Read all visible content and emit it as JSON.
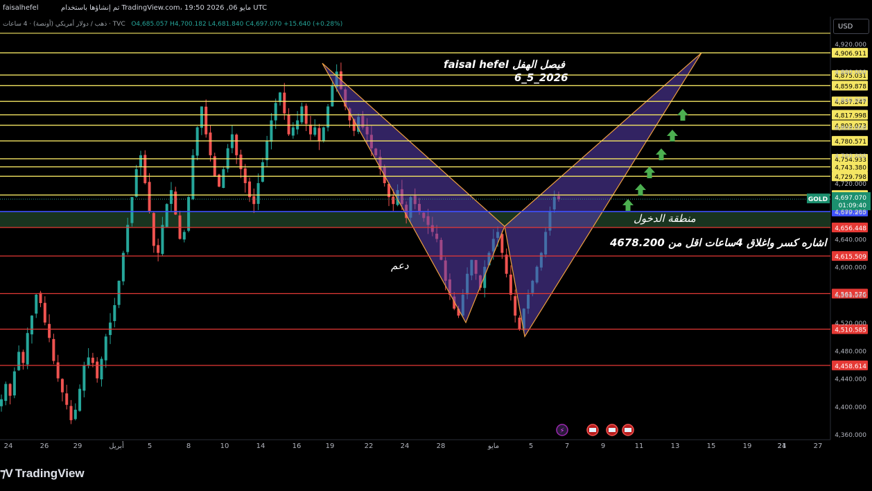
{
  "header": {
    "publisher": "faisalhefel",
    "published_on": "تم إنشاؤها باستخدام TradingView.com، مايو 06, 2026 19:50 UTC"
  },
  "legend_text": "ذهب / دولار أمريكي (أونصة) · 4 ساعات · TVC",
  "legend_ohlc": "O4,685.057  H4,700.182  L4,681.840  C4,697.070  +15.640 (+0.28%)",
  "currency_button": "USD",
  "logo_text": "TradingView",
  "annotations": {
    "author": "faisal hefel فيصل الهفل",
    "date": "6_5_2026",
    "entry_zone": "منطقة الدخول",
    "support": "دعم",
    "stop_note": "اشاره كسر واغلاق 4ساعات اقل من 4678.200"
  },
  "colors": {
    "background": "#000000",
    "bull": "#26a69a",
    "bear": "#ef5350",
    "resistance_line": "#f5e663",
    "support_line": "#e53935",
    "entry_line": "#3f51ff",
    "pattern_fill": "#5b3fb3",
    "pattern_stroke": "#f0a040",
    "arrow": "#4caf50",
    "current_price_tag": "#1b8f6e"
  },
  "chart_data": {
    "type": "candlestick",
    "symbol": "GOLD",
    "timeframe": "4h",
    "x_tick_labels": [
      "24",
      "26",
      "29",
      "أبريل",
      "5",
      "8",
      "10",
      "14",
      "16",
      "19",
      "22",
      "24",
      "28",
      "مايو",
      "5",
      "7",
      "9",
      "11",
      "13",
      "15",
      "19",
      "21",
      "24",
      "27"
    ],
    "y_tick_labels": [
      "4,920.000",
      "4,880.000",
      "4,840.000",
      "4,800.000",
      "4,760.000",
      "4,720.000",
      "4,680.000",
      "4,640.000",
      "4,600.000",
      "4,560.000",
      "4,520.000",
      "4,480.000",
      "4,440.000",
      "4,400.000",
      "4,360.000"
    ],
    "y_ticks": [
      4920,
      4880,
      4840,
      4800,
      4760,
      4720,
      4680,
      4640,
      4600,
      4560,
      4520,
      4480,
      4440,
      4400,
      4360
    ],
    "ylim": [
      4350,
      4945
    ],
    "current_price": {
      "label": "GOLD",
      "value": "4,697.070",
      "countdown": "01:09:40"
    },
    "resistance_levels": [
      "4,906.911",
      "4,875.031",
      "4,859.878",
      "4,837.247",
      "4,817.998",
      "4,803.073",
      "4,780.571",
      "4,754.933",
      "4,743.380",
      "4,729.798",
      "4,702.942"
    ],
    "entry_level": "4,679.265",
    "support_levels": [
      "4,656.448",
      "4,615.509",
      "4,561.576",
      "4,510.585",
      "4,458.614"
    ],
    "pattern_points": [
      {
        "x": "Apr 18",
        "y": 4892
      },
      {
        "x": "Apr 30",
        "y": 4520
      },
      {
        "x": "May 3",
        "y": 4658
      },
      {
        "x": "May 5",
        "y": 4500
      },
      {
        "x": "May 17",
        "y": 4906.911
      }
    ],
    "closes": [
      4410,
      4432,
      4415,
      4450,
      4478,
      4462,
      4505,
      4530,
      4560,
      4548,
      4520,
      4498,
      4465,
      4440,
      4420,
      4402,
      4380,
      4395,
      4425,
      4458,
      4470,
      4462,
      4440,
      4468,
      4500,
      4520,
      4545,
      4580,
      4620,
      4660,
      4700,
      4740,
      4760,
      4720,
      4680,
      4630,
      4620,
      4660,
      4690,
      4710,
      4675,
      4640,
      4650,
      4700,
      4760,
      4800,
      4830,
      4790,
      4760,
      4730,
      4715,
      4740,
      4770,
      4790,
      4760,
      4740,
      4720,
      4700,
      4690,
      4720,
      4750,
      4780,
      4810,
      4835,
      4850,
      4820,
      4790,
      4800,
      4810,
      4830,
      4805,
      4790,
      4800,
      4780,
      4800,
      4830,
      4860,
      4880,
      4855,
      4830,
      4810,
      4795,
      4815,
      4800,
      4790,
      4770,
      4760,
      4740,
      4720,
      4700,
      4690,
      4710,
      4690,
      4670,
      4700,
      4690,
      4680,
      4670,
      4660,
      4650,
      4640,
      4610,
      4580,
      4560,
      4540,
      4530,
      4560,
      4590,
      4610,
      4590,
      4570,
      4600,
      4620,
      4640,
      4650,
      4620,
      4590,
      4560,
      4530,
      4510,
      4540,
      4560,
      4580,
      4600,
      4620,
      4650,
      4680,
      4700,
      4697
    ]
  }
}
